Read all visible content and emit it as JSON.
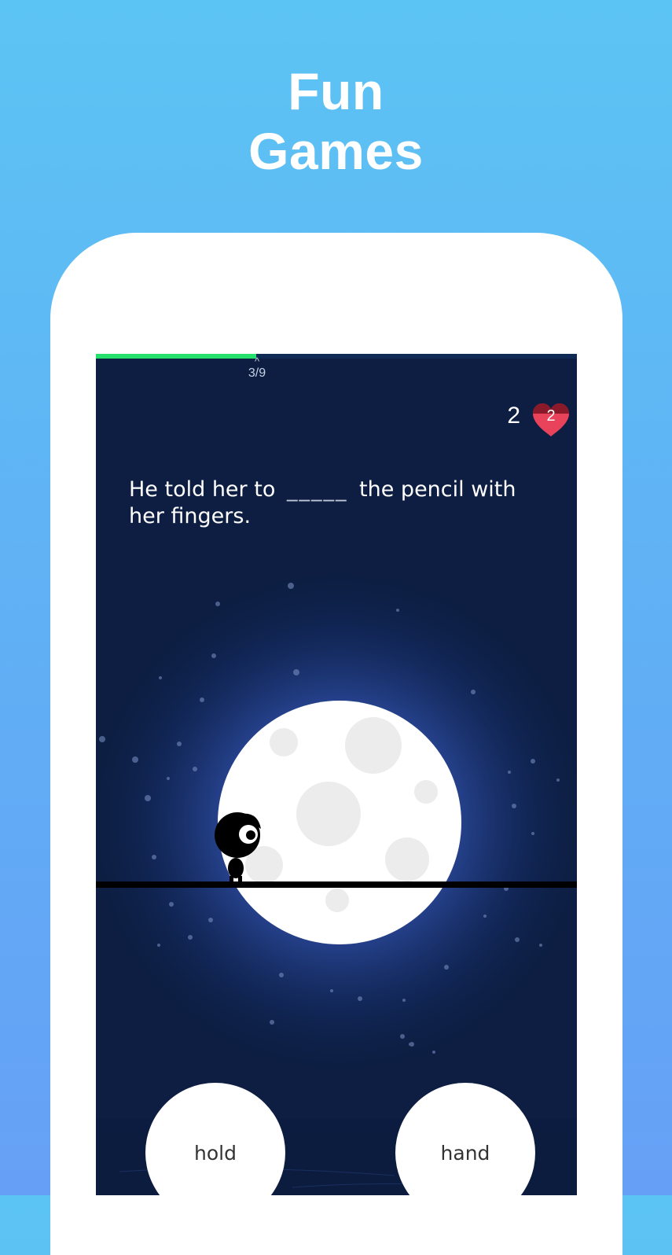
{
  "promo": {
    "title_line1": "Fun",
    "title_line2": "Games"
  },
  "game": {
    "progress": {
      "current": 3,
      "total": 9,
      "label": "3/9",
      "fraction": 0.333
    },
    "lives": {
      "count": "2",
      "heart_value": "2"
    },
    "question": {
      "before_blank": "He told her to",
      "blank": "_____",
      "after_blank": "the pencil with her fingers."
    },
    "choices": [
      {
        "label": "hold"
      },
      {
        "label": "hand"
      }
    ]
  },
  "colors": {
    "background_top": "#5cc4f4",
    "background_bottom": "#66a0f6",
    "screen_bg": "#0d1e42",
    "progress_fill": "#25e06a",
    "heart": "#e8435a",
    "moon": "#ffffff"
  },
  "icons": {
    "lives": "heart-icon",
    "character": "shadow-character",
    "moon": "full-moon"
  }
}
